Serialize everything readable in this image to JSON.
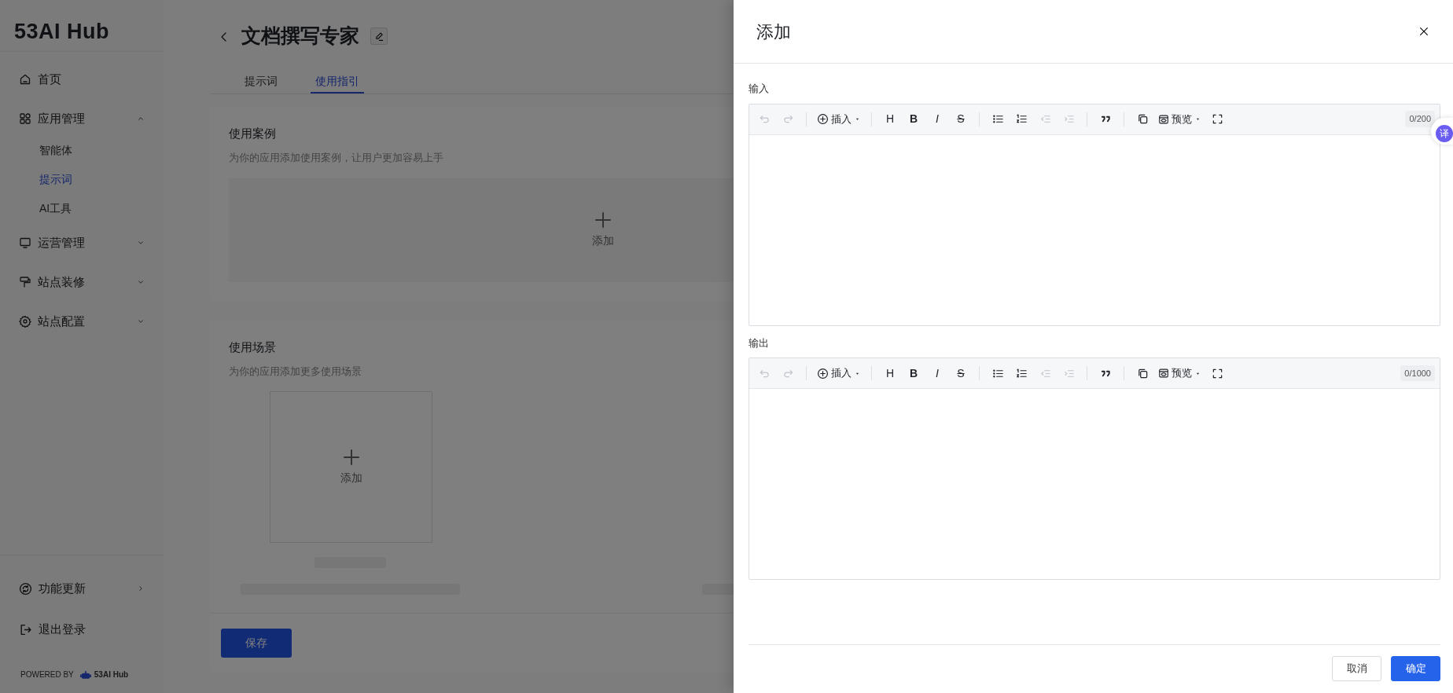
{
  "sidebar": {
    "logo": "53AI Hub",
    "items": [
      {
        "kind": "link",
        "label": "首页"
      },
      {
        "kind": "group",
        "label": "应用管理",
        "expanded": true,
        "children": [
          {
            "label": "智能体",
            "selected": false
          },
          {
            "label": "提示词",
            "selected": true
          },
          {
            "label": "AI工具",
            "selected": false
          }
        ]
      },
      {
        "kind": "group",
        "label": "运营管理",
        "expanded": false
      },
      {
        "kind": "group",
        "label": "站点装修",
        "expanded": false
      },
      {
        "kind": "group",
        "label": "站点配置",
        "expanded": false
      }
    ],
    "footer_items": [
      {
        "label": "功能更新"
      },
      {
        "label": "退出登录"
      }
    ],
    "powered_by": {
      "text": "POWERED BY",
      "brand": "53AI Hub"
    }
  },
  "main": {
    "title": "文档撰写专家",
    "tabs": [
      {
        "label": "提示词",
        "selected": false
      },
      {
        "label": "使用指引",
        "selected": true
      }
    ],
    "sections": [
      {
        "kind": "wide",
        "title": "使用案例",
        "description": "为你的应用添加使用案例，让用户更加容易上手",
        "add_label": "添加"
      },
      {
        "kind": "tile",
        "title": "使用场景",
        "description": "为你的应用添加更多使用场景",
        "add_label": "添加"
      }
    ],
    "save_button": "保存"
  },
  "drawer": {
    "title": "添加",
    "editors": [
      {
        "label": "输入",
        "counter": "0/200",
        "toolbar": [
          {
            "kind": "undo",
            "disabled": true
          },
          {
            "kind": "redo",
            "disabled": true
          },
          {
            "kind": "sep"
          },
          {
            "kind": "insert",
            "label": "插入",
            "disabled": false
          },
          {
            "kind": "sep"
          },
          {
            "kind": "text",
            "label": "H",
            "disabled": false
          },
          {
            "kind": "bold",
            "label": "B",
            "disabled": false
          },
          {
            "kind": "italic",
            "label": "I",
            "disabled": false
          },
          {
            "kind": "strike",
            "label": "S",
            "disabled": false
          },
          {
            "kind": "sep"
          },
          {
            "kind": "ul",
            "disabled": false
          },
          {
            "kind": "ol",
            "disabled": false
          },
          {
            "kind": "outdent",
            "disabled": true
          },
          {
            "kind": "indent",
            "disabled": true
          },
          {
            "kind": "sep"
          },
          {
            "kind": "quote",
            "disabled": false
          },
          {
            "kind": "sep"
          },
          {
            "kind": "copy",
            "disabled": false
          },
          {
            "kind": "preview",
            "label": "预览",
            "disabled": false
          },
          {
            "kind": "fullscreen",
            "disabled": false
          }
        ]
      },
      {
        "label": "输出",
        "counter": "0/1000",
        "toolbar": [
          {
            "kind": "undo",
            "disabled": true
          },
          {
            "kind": "redo",
            "disabled": true
          },
          {
            "kind": "sep"
          },
          {
            "kind": "insert",
            "label": "插入",
            "disabled": false
          },
          {
            "kind": "sep"
          },
          {
            "kind": "text",
            "label": "H",
            "disabled": false
          },
          {
            "kind": "bold",
            "label": "B",
            "disabled": false
          },
          {
            "kind": "italic",
            "label": "I",
            "disabled": false
          },
          {
            "kind": "strike",
            "label": "S",
            "disabled": false
          },
          {
            "kind": "sep"
          },
          {
            "kind": "ul",
            "disabled": false
          },
          {
            "kind": "ol",
            "disabled": false
          },
          {
            "kind": "outdent",
            "disabled": true
          },
          {
            "kind": "indent",
            "disabled": true
          },
          {
            "kind": "sep"
          },
          {
            "kind": "quote",
            "disabled": false
          },
          {
            "kind": "sep"
          },
          {
            "kind": "copy",
            "disabled": false
          },
          {
            "kind": "preview",
            "label": "预览",
            "disabled": false
          },
          {
            "kind": "fullscreen",
            "disabled": false
          }
        ]
      }
    ],
    "buttons": [
      {
        "kind": "secondary",
        "label": "取消"
      },
      {
        "kind": "primary",
        "label": "确定"
      }
    ]
  },
  "floating_button": {
    "label": "译"
  }
}
